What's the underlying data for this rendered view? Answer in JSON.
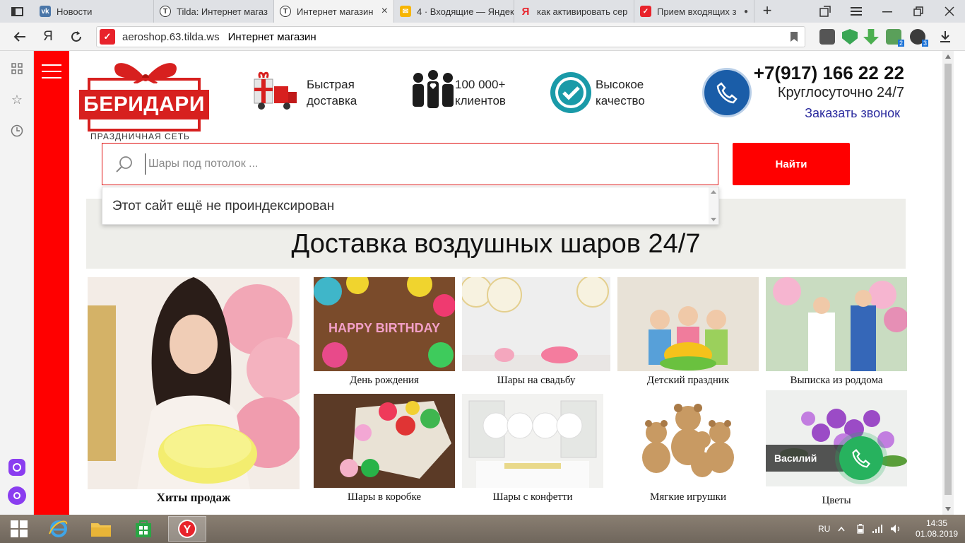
{
  "browser": {
    "tabs": [
      {
        "label": "Новости",
        "favicon": "vk-icon",
        "color": "#4a76a8"
      },
      {
        "label": "Tilda: Интернет магаз",
        "favicon": "tilda-icon",
        "color": "#333333"
      },
      {
        "label": "Интернет магазин",
        "favicon": "tilda-icon",
        "color": "#333333",
        "close": "×"
      },
      {
        "label": "4 · Входящие — Яндек",
        "favicon": "yandex-mail-icon",
        "color": "#f7b500"
      },
      {
        "label": "как активировать сер",
        "favicon": "yandex-icon",
        "color": "#e8232b"
      },
      {
        "label": "Прием входящих з",
        "favicon": "tilda-red-icon",
        "color": "#e8232b",
        "close": "●"
      }
    ],
    "new_tab": "+",
    "url_domain": "aeroshop.63.tilda.ws",
    "url_title": "Интернет магазин",
    "yandex_letter": "Я",
    "ext_badges": [
      "2",
      "3"
    ]
  },
  "site": {
    "logo": {
      "name": "БЕРИДАРИ",
      "subtitle": "ПРАЗДНИЧНАЯ СЕТЬ"
    },
    "features": [
      {
        "line1": "Быстрая",
        "line2": "доставка",
        "icon": "delivery-truck-icon"
      },
      {
        "line1": "100 000+",
        "line2": "клиентов",
        "icon": "people-icon"
      },
      {
        "line1": "Высокое",
        "line2": "качество",
        "icon": "quality-check-icon"
      }
    ],
    "contacts": {
      "phone": "+7(917) 166 22 22",
      "hours": "Круглосуточно 24/7",
      "callback": "Заказать звонок"
    },
    "search": {
      "placeholder": "Шары под потолок ...",
      "button": "Найти",
      "dropdown_message": "Этот сайт ещё не проиндексирован"
    },
    "banner_title": "Доставка воздушных шаров 24/7",
    "categories": {
      "hits": "Хиты продаж",
      "row1": [
        "День рождения",
        "Шары на свадьбу",
        "Детский праздник",
        "Выписка из роддома"
      ],
      "row2": [
        "Шары в коробке",
        "Шары с конфетти",
        "Мягкие игрушки",
        "Цветы"
      ]
    },
    "chat": {
      "agent": "Василий"
    }
  },
  "taskbar": {
    "lang": "RU",
    "time": "14:35",
    "date": "01.08.2019"
  }
}
